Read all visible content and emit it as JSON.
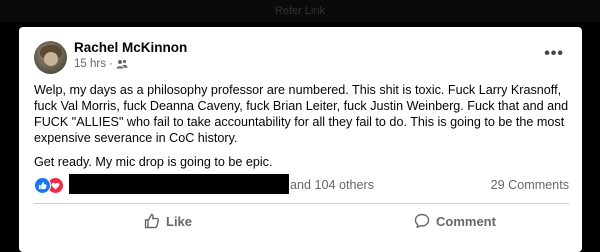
{
  "header": {
    "partial_text": "Refer Link"
  },
  "post": {
    "author": "Rachel McKinnon",
    "time": "15 hrs",
    "separator": "·",
    "paragraphs": [
      "Welp, my days as a philosophy professor are numbered. This shit is toxic. Fuck Larry Krasnoff, fuck Val Morris, fuck Deanna Caveny, fuck Brian Leiter, fuck Justin Weinberg. Fuck that and and FUCK \"ALLIES\" who fail to take accountability for all they fail to do. This is going to be the most expensive severance in CoC history.",
      "Get ready. My mic drop is going to be epic."
    ],
    "reactions": {
      "others": "and 104 others",
      "icons": [
        "like-icon",
        "love-icon"
      ],
      "colors": {
        "like": "#1877f2",
        "love": "#f0284a"
      }
    },
    "comments_count": "29 Comments",
    "actions": {
      "like": "Like",
      "comment": "Comment"
    }
  }
}
